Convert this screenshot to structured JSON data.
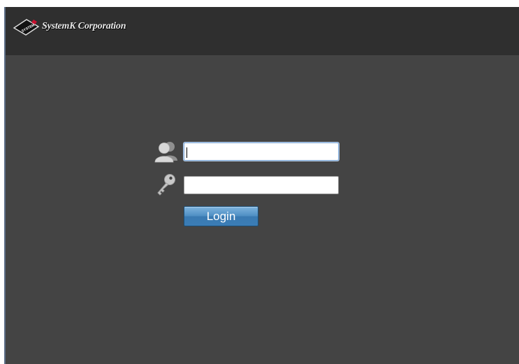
{
  "header": {
    "brand_name": "SystemK Corporation",
    "logo_mark_text": "SYSTEM"
  },
  "login": {
    "username_value": "",
    "password_value": "",
    "button_label": "Login"
  },
  "icons": {
    "username": "user-icon",
    "password": "key-icon"
  },
  "colors": {
    "background": "#444444",
    "header": "#2f2f2f",
    "button": "#3f7fb8"
  }
}
